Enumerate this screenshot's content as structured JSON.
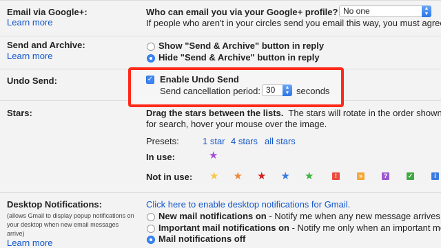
{
  "email_via_gplus": {
    "label": "Email via Google+:",
    "learn_more": "Learn more",
    "question": "Who can email you via your Google+ profile?",
    "select_value": "No one",
    "description": "If people who aren't in your circles send you email this way, you must agree"
  },
  "send_archive": {
    "label": "Send and Archive:",
    "learn_more": "Learn more",
    "options": [
      {
        "label": "Show \"Send & Archive\" button in reply",
        "selected": false
      },
      {
        "label": "Hide \"Send & Archive\" button in reply",
        "selected": true
      }
    ]
  },
  "undo_send": {
    "label": "Undo Send:",
    "enable_label": "Enable Undo Send",
    "enabled": true,
    "period_label": "Send cancellation period:",
    "period_value": "30",
    "seconds_label": "seconds"
  },
  "stars": {
    "label": "Stars:",
    "instruction_bold": "Drag the stars between the lists.",
    "instruction_rest": "The stars will rotate in the order shown b",
    "instruction_line2": "for search, hover your mouse over the image.",
    "presets_label": "Presets:",
    "presets": [
      "1 star",
      "4 stars",
      "all stars"
    ],
    "in_use_label": "In use:",
    "not_in_use_label": "Not in use:",
    "in_use_colors": [
      "#a64bd8"
    ],
    "not_in_use_stars": [
      "#f5c84a",
      "#ef8a3a",
      "#d11f1f",
      "#3b7ae0",
      "#3fb33f"
    ],
    "not_in_use_squares": [
      {
        "glyph": "!",
        "bg": "#ea4b3c",
        "color": "#ffffff"
      },
      {
        "glyph": "»",
        "bg": "#f2a83a",
        "color": "#ffffff"
      },
      {
        "glyph": "?",
        "bg": "#9b59d0",
        "color": "#ffffff"
      },
      {
        "glyph": "✓",
        "bg": "#3faa3f",
        "color": "#ffffff"
      },
      {
        "glyph": "i",
        "bg": "#3b7ae0",
        "color": "#ffffff"
      }
    ]
  },
  "desktop_notifications": {
    "label": "Desktop Notifications:",
    "small_note_1": "(allows Gmail to display popup notifications on",
    "small_note_2": "your desktop when new email messages",
    "small_note_3": "arrive)",
    "learn_more": "Learn more",
    "enable_link": "Click here to enable desktop notifications for Gmail.",
    "options": [
      {
        "bold": "New mail notifications on",
        "rest": " - Notify me when any new message arrives in",
        "selected": false
      },
      {
        "bold": "Important mail notifications on",
        "rest": " - Notify me only when an important me",
        "selected": false
      },
      {
        "bold": "Mail notifications off",
        "rest": "",
        "selected": true
      }
    ]
  }
}
